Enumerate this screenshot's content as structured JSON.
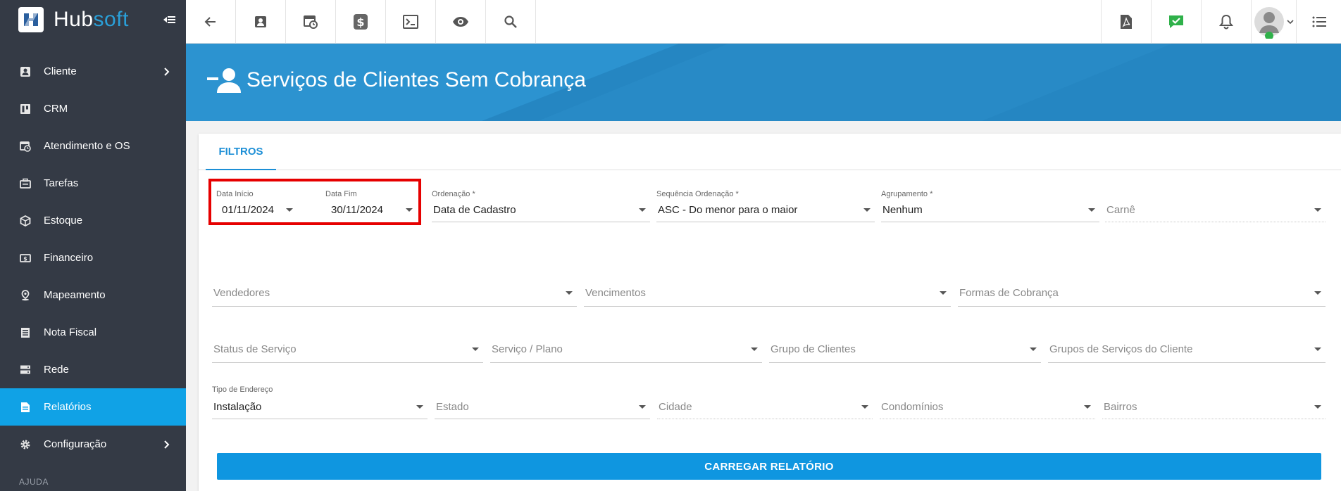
{
  "brand": {
    "name_part1": "Hub",
    "name_part2": "soft",
    "accent": "#2a9fd8"
  },
  "sidebar": {
    "items": [
      {
        "label": "Cliente",
        "icon": "contact-card-icon",
        "has_children": true
      },
      {
        "label": "CRM",
        "icon": "kanban-icon",
        "has_children": false
      },
      {
        "label": "Atendimento e OS",
        "icon": "calendar-clock-icon",
        "has_children": false
      },
      {
        "label": "Tarefas",
        "icon": "briefcase-icon",
        "has_children": false
      },
      {
        "label": "Estoque",
        "icon": "box-icon",
        "has_children": false
      },
      {
        "label": "Financeiro",
        "icon": "money-icon",
        "has_children": false
      },
      {
        "label": "Mapeamento",
        "icon": "map-pin-icon",
        "has_children": false
      },
      {
        "label": "Nota Fiscal",
        "icon": "receipt-icon",
        "has_children": false
      },
      {
        "label": "Rede",
        "icon": "server-icon",
        "has_children": false
      },
      {
        "label": "Relatórios",
        "icon": "report-icon",
        "has_children": false,
        "active": true
      },
      {
        "label": "Configuração",
        "icon": "gear-icon",
        "has_children": true
      }
    ],
    "section_label": "AJUDA"
  },
  "header": {
    "title": "Serviços de Clientes Sem Cobrança"
  },
  "tabs": [
    {
      "label": "FILTROS"
    }
  ],
  "filters": {
    "data_inicio": {
      "label": "Data Início",
      "value": "01/11/2024"
    },
    "data_fim": {
      "label": "Data Fim",
      "value": "30/11/2024"
    },
    "ordenacao": {
      "label": "Ordenação *",
      "value": "Data de Cadastro"
    },
    "sequencia": {
      "label": "Sequência Ordenação *",
      "value": "ASC - Do menor para o maior"
    },
    "agrupamento": {
      "label": "Agrupamento *",
      "value": "Nenhum"
    },
    "carne": {
      "placeholder": "Carnê"
    },
    "vendedores": {
      "placeholder": "Vendedores"
    },
    "vencimentos": {
      "placeholder": "Vencimentos"
    },
    "formas_cobranca": {
      "placeholder": "Formas de Cobrança"
    },
    "status_servico": {
      "placeholder": "Status de Serviço"
    },
    "servico_plano": {
      "placeholder": "Serviço / Plano"
    },
    "grupo_clientes": {
      "placeholder": "Grupo de Clientes"
    },
    "grupos_servicos": {
      "placeholder": "Grupos de Serviços do Cliente"
    },
    "tipo_endereco": {
      "label": "Tipo de Endereço",
      "value": "Instalação"
    },
    "estado": {
      "placeholder": "Estado"
    },
    "cidade": {
      "placeholder": "Cidade"
    },
    "condominios": {
      "placeholder": "Condomínios"
    },
    "bairros": {
      "placeholder": "Bairros"
    }
  },
  "actions": {
    "load_report": "CARREGAR RELATÓRIO"
  }
}
